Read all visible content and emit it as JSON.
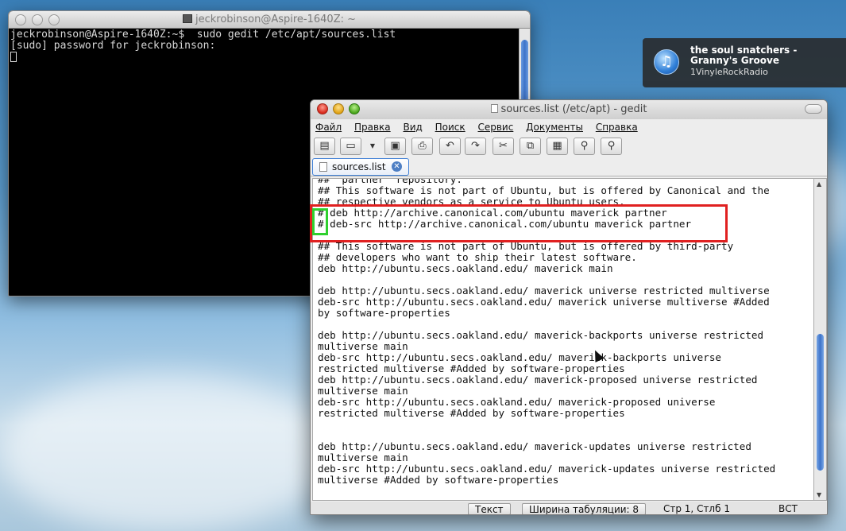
{
  "terminal": {
    "title": "jeckrobinson@Aspire-1640Z: ~",
    "lines": [
      "jeckrobinson@Aspire-1640Z:~$  sudo gedit /etc/apt/sources.list",
      "[sudo] password for jeckrobinson:"
    ]
  },
  "notification": {
    "title": "the soul snatchers - Granny's Groove",
    "subtitle": "1VinyleRockRadio"
  },
  "gedit": {
    "title": "sources.list (/etc/apt) - gedit",
    "menu": [
      "Файл",
      "Правка",
      "Вид",
      "Поиск",
      "Сервис",
      "Документы",
      "Справка"
    ],
    "tab_label": "sources.list",
    "code_lines": [
      "##  partner  repository.",
      "## This software is not part of Ubuntu, but is offered by Canonical and the",
      "## respective vendors as a service to Ubuntu users.",
      "# deb http://archive.canonical.com/ubuntu maverick partner",
      "# deb-src http://archive.canonical.com/ubuntu maverick partner",
      "",
      "## This software is not part of Ubuntu, but is offered by third-party",
      "## developers who want to ship their latest software.",
      "deb http://ubuntu.secs.oakland.edu/ maverick main",
      "",
      "deb http://ubuntu.secs.oakland.edu/ maverick universe restricted multiverse",
      "deb-src http://ubuntu.secs.oakland.edu/ maverick universe multiverse #Added",
      "by software-properties",
      "",
      "deb http://ubuntu.secs.oakland.edu/ maverick-backports universe restricted",
      "multiverse main",
      "deb-src http://ubuntu.secs.oakland.edu/ maverick-backports universe",
      "restricted multiverse #Added by software-properties",
      "deb http://ubuntu.secs.oakland.edu/ maverick-proposed universe restricted",
      "multiverse main",
      "deb-src http://ubuntu.secs.oakland.edu/ maverick-proposed universe",
      "restricted multiverse #Added by software-properties",
      "",
      "",
      "deb http://ubuntu.secs.oakland.edu/ maverick-updates universe restricted",
      "multiverse main",
      "deb-src http://ubuntu.secs.oakland.edu/ maverick-updates universe restricted",
      "multiverse #Added by software-properties"
    ],
    "status": {
      "mode": "Текст",
      "tab_width": "Ширина табуляции:  8",
      "position": "Стр 1, Стлб 1",
      "insert": "ВСТ"
    },
    "toolbar_icons": [
      "new-doc-icon",
      "open-icon",
      "save-icon",
      "print-icon",
      "undo-icon",
      "redo-icon",
      "cut-icon",
      "copy-icon",
      "paste-icon",
      "find-icon",
      "find-replace-icon"
    ]
  },
  "highlight_colors": {
    "red": "#e02020",
    "green": "#2fd02f"
  }
}
